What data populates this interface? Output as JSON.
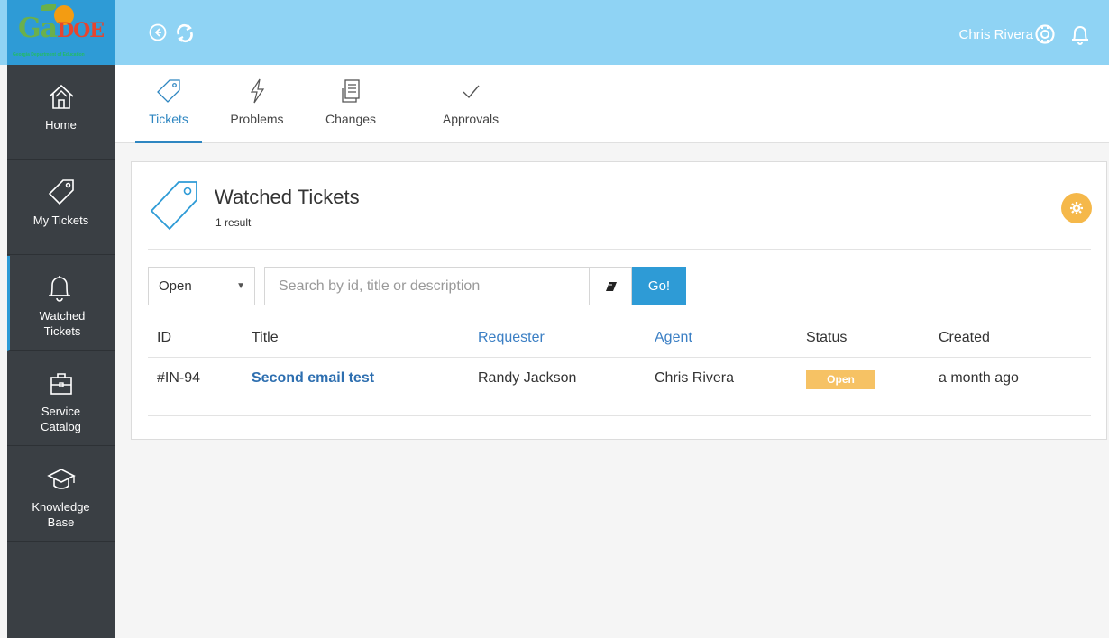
{
  "app": {
    "logo_text": "Ga",
    "logo_text_suffix": "DOE",
    "logo_subtitle": "Georgia Department of Education",
    "user_name": "Chris Rivera",
    "brand_color": "#8fd3f4",
    "accent_color": "#2e9bd6"
  },
  "topbar": {
    "back_icon": "circle-arrow-left-icon",
    "refresh_icon": "refresh-icon",
    "support_icon": "lifebuoy-icon",
    "notifications_icon": "bell-icon"
  },
  "sidebar": {
    "items": [
      {
        "label": "Home",
        "icon": "home-icon"
      },
      {
        "label": "My Tickets",
        "icon": "tag-icon"
      },
      {
        "label": "Watched Tickets",
        "icon": "bell-icon",
        "active": true
      },
      {
        "label": "Service Catalog",
        "icon": "briefcase-icon"
      },
      {
        "label": "Knowledge Base",
        "icon": "graduation-cap-icon"
      }
    ]
  },
  "tabs": [
    {
      "label": "Tickets",
      "icon": "tag-icon",
      "active": true
    },
    {
      "label": "Problems",
      "icon": "lightning-icon"
    },
    {
      "label": "Changes",
      "icon": "document-icon"
    },
    {
      "label": "Approvals",
      "icon": "checkmark-icon"
    }
  ],
  "card": {
    "title": "Watched Tickets",
    "result_count": "1 result",
    "settings_icon": "gear-icon"
  },
  "filters": {
    "status_selected": "Open",
    "search_placeholder": "Search by id, title or description",
    "clear_icon": "eraser-icon",
    "go_label": "Go!"
  },
  "table": {
    "columns": [
      "ID",
      "Title",
      "Requester",
      "Agent",
      "Status",
      "Created"
    ],
    "rows": [
      {
        "id": "#IN-94",
        "title": "Second email test",
        "requester": "Randy Jackson",
        "agent": "Chris Rivera",
        "status": "Open",
        "created": "a month ago"
      }
    ]
  }
}
